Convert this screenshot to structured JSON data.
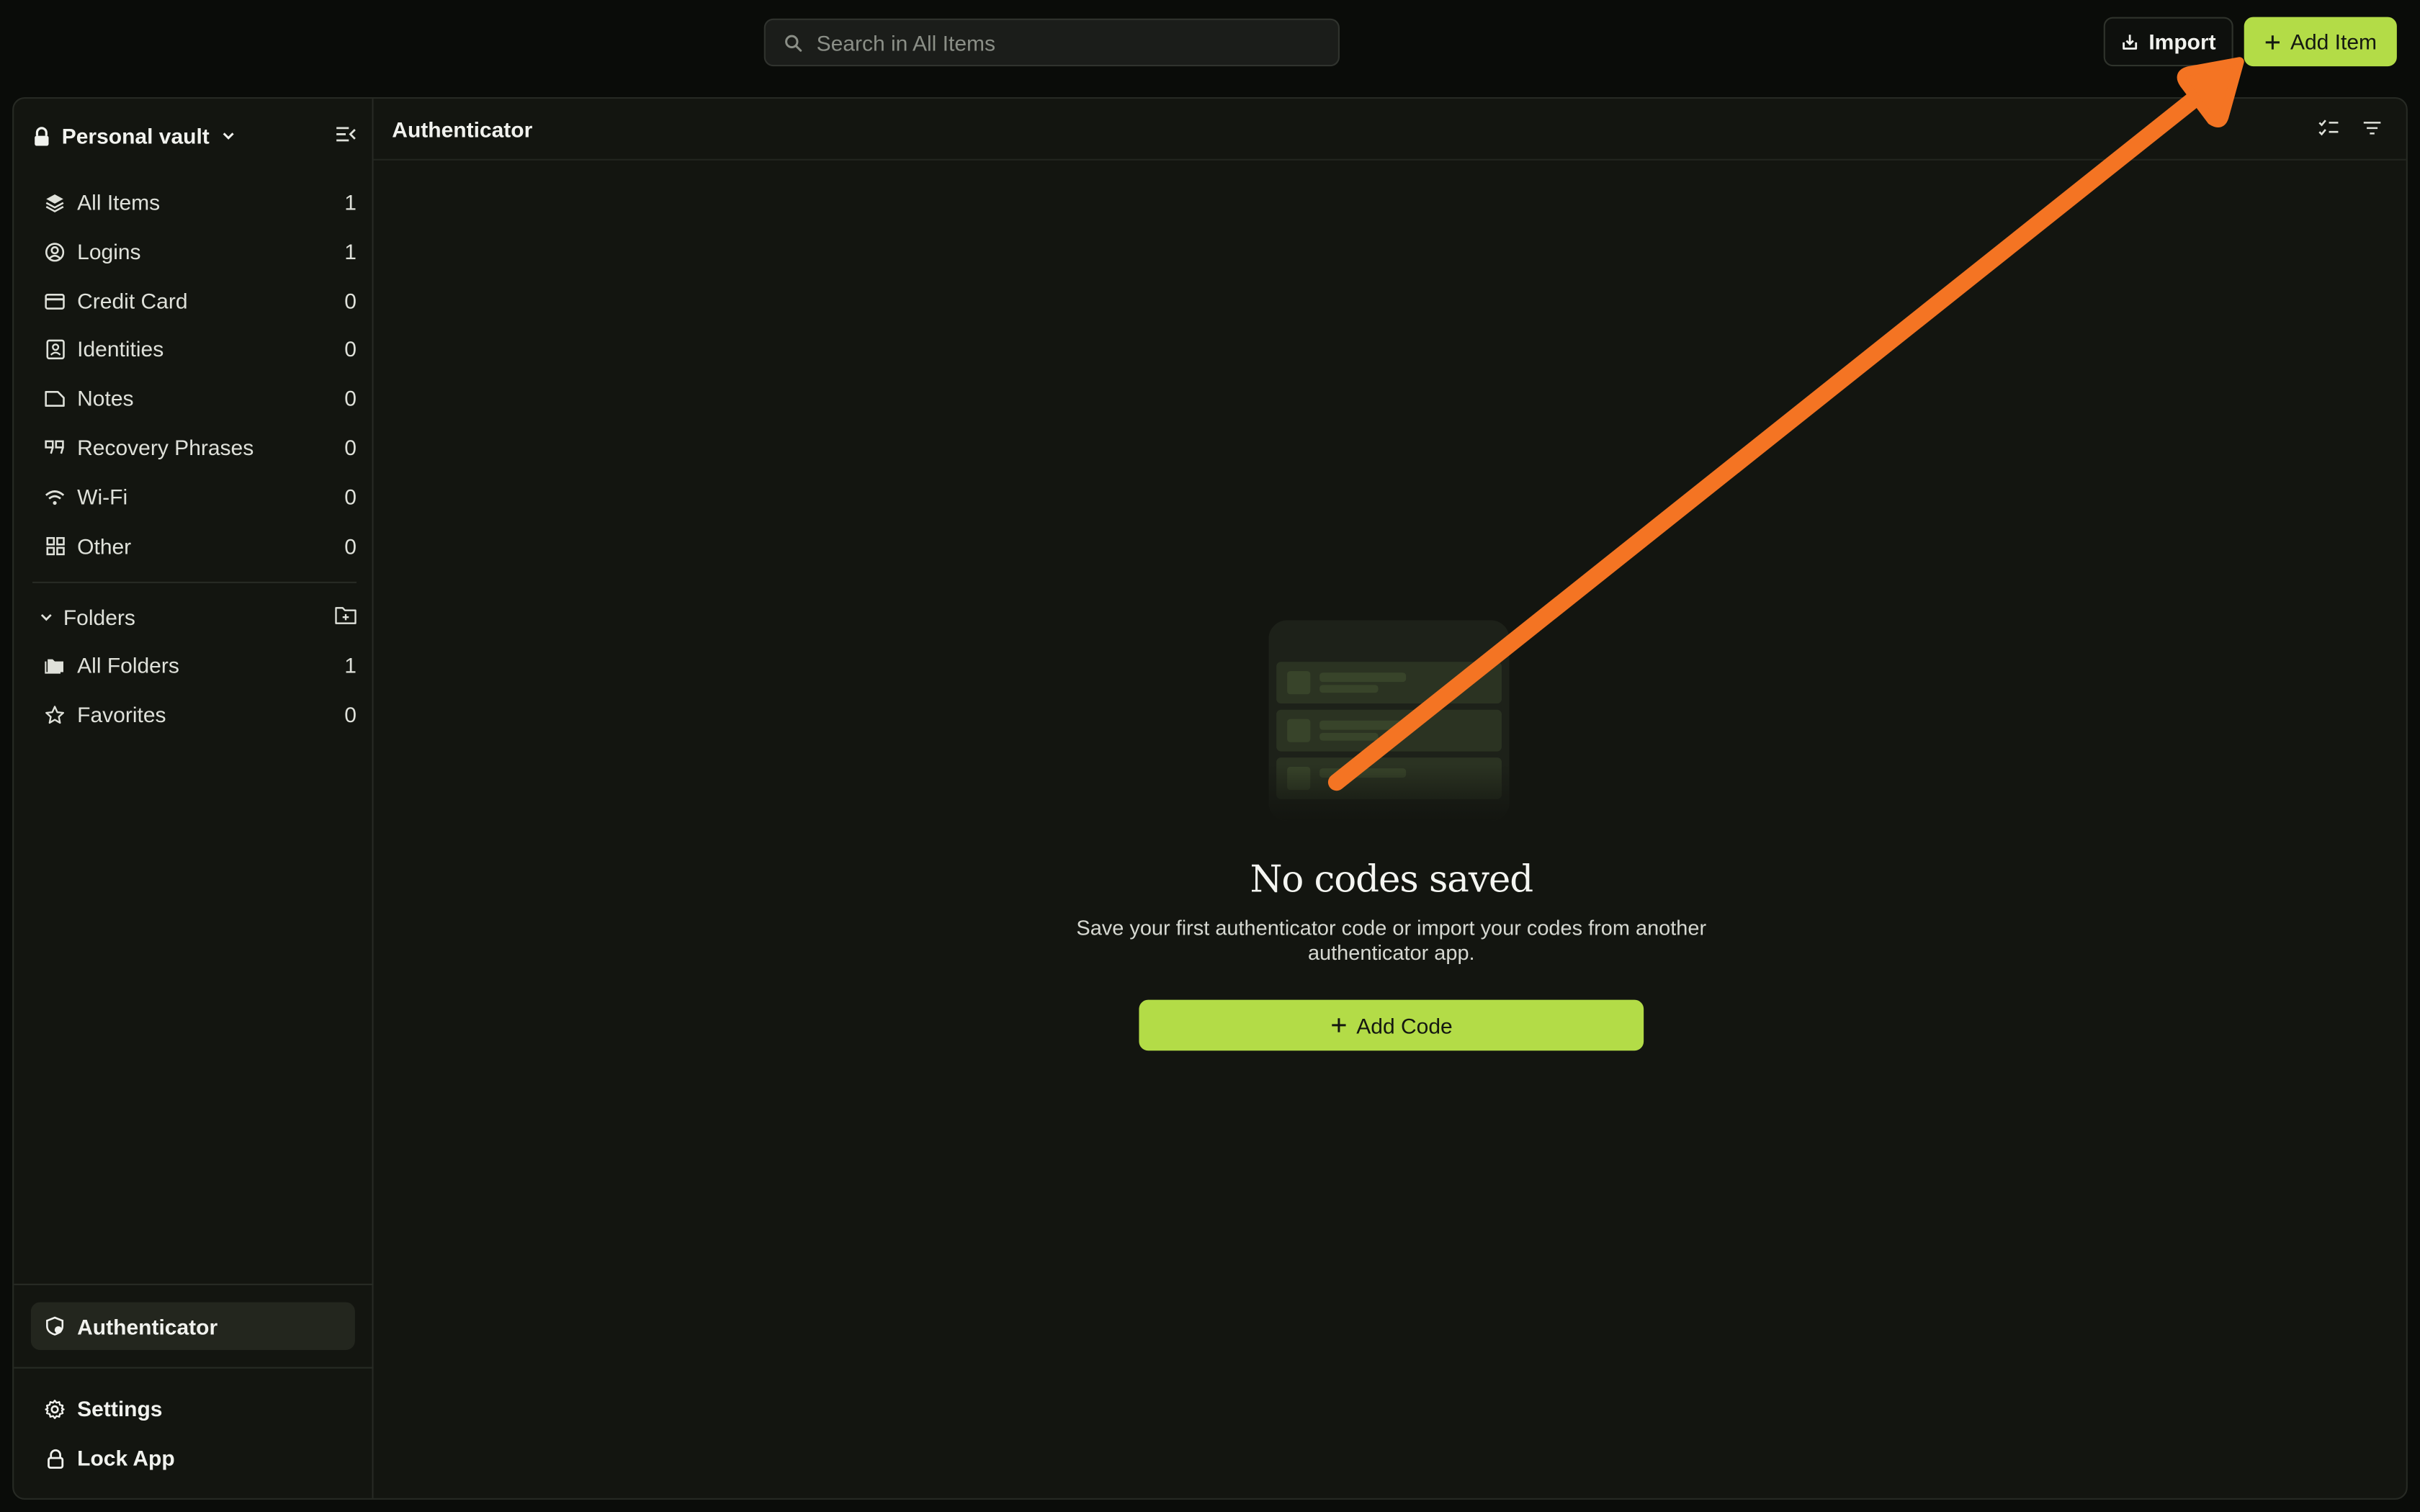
{
  "search": {
    "placeholder": "Search in All Items"
  },
  "toolbar": {
    "import_label": "Import",
    "add_item_label": "Add Item"
  },
  "vault": {
    "name": "Personal vault"
  },
  "sidebar": {
    "items": [
      {
        "label": "All Items",
        "count": "1",
        "icon": "layers-icon"
      },
      {
        "label": "Logins",
        "count": "1",
        "icon": "user-circle-icon"
      },
      {
        "label": "Credit Card",
        "count": "0",
        "icon": "credit-card-icon"
      },
      {
        "label": "Identities",
        "count": "0",
        "icon": "id-badge-icon"
      },
      {
        "label": "Notes",
        "count": "0",
        "icon": "note-icon"
      },
      {
        "label": "Recovery Phrases",
        "count": "0",
        "icon": "quote-icon"
      },
      {
        "label": "Wi-Fi",
        "count": "0",
        "icon": "wifi-icon"
      },
      {
        "label": "Other",
        "count": "0",
        "icon": "grid-icon"
      }
    ],
    "folders_label": "Folders",
    "folders": [
      {
        "label": "All Folders",
        "count": "1",
        "icon": "folders-icon"
      },
      {
        "label": "Favorites",
        "count": "0",
        "icon": "star-icon"
      }
    ],
    "authenticator_label": "Authenticator",
    "settings_label": "Settings",
    "lock_label": "Lock App"
  },
  "main": {
    "title": "Authenticator",
    "empty_title": "No codes saved",
    "empty_subtitle": "Save your first authenticator code or import your codes from another authenticator app.",
    "add_code_label": "Add Code"
  },
  "colors": {
    "accent": "#b3dc47",
    "annotation_arrow": "#f47423",
    "background": "#131510"
  }
}
